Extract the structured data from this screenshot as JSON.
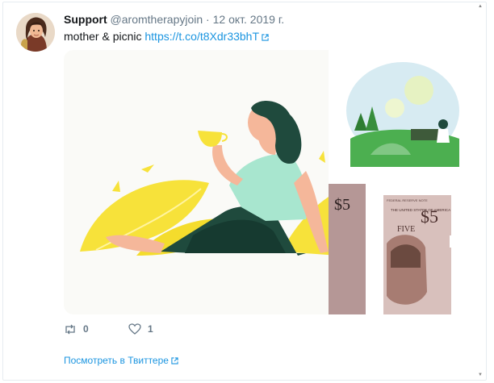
{
  "tweet": {
    "author_name": "Support",
    "handle": "@aromtherapyjoin",
    "separator": "·",
    "date": "12 окт. 2019 г.",
    "text": "mother & picnic",
    "link": "https://t.co/t8Xdr33bhT"
  },
  "media": {
    "banknote_value": "$5",
    "banknote_small_value": "$5",
    "banknote_word": "FIVE",
    "banknote_header": "FEDERAL RESERVE NOTE",
    "banknote_country": "THE UNITED STATES OF AMERICA"
  },
  "actions": {
    "retweet_count": "0",
    "like_count": "1"
  },
  "footer": {
    "view_on_twitter": "Посмотреть в Твиттере"
  },
  "colors": {
    "link": "#1b95e0",
    "muted": "#657786",
    "leaf_yellow": "#f7e23a",
    "woman_shirt": "#a8e6cf",
    "woman_pants": "#1f4a3d"
  }
}
